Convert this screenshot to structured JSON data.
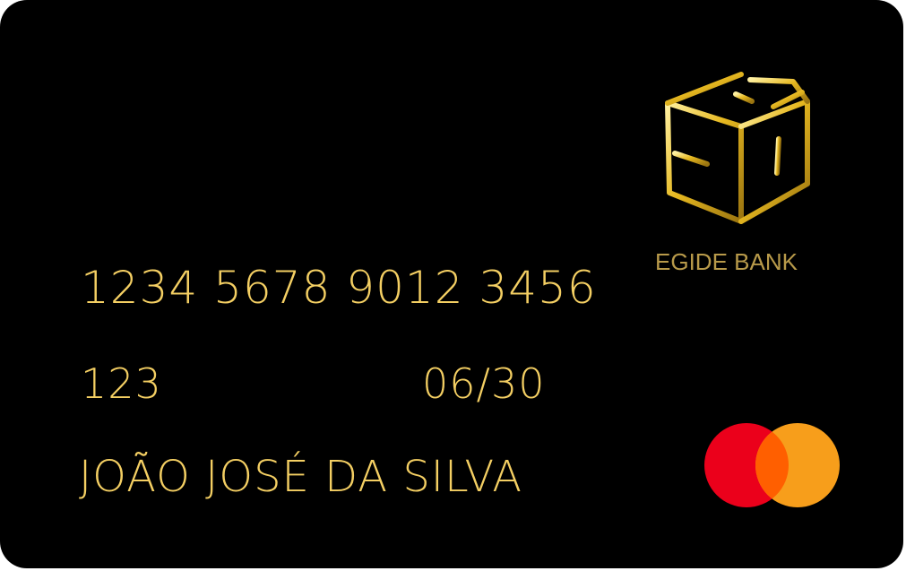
{
  "card": {
    "number": "1234 5678 9012 3456",
    "cvv": "123",
    "expiry": "06/30",
    "holder_name": "JOÃO JOSÉ DA SILVA",
    "bank_name": "EGIDE BANK",
    "logo_icon": "gold-cube-logo-icon",
    "network_icon": "mastercard-logo-icon"
  },
  "colors": {
    "card_background": "#000000",
    "text_gold": "#f4cf63",
    "bank_name_gold": "#b89a4a",
    "mastercard_red": "#eb001b",
    "mastercard_orange": "#f79e1b",
    "mastercard_overlap": "#ff5f00"
  }
}
